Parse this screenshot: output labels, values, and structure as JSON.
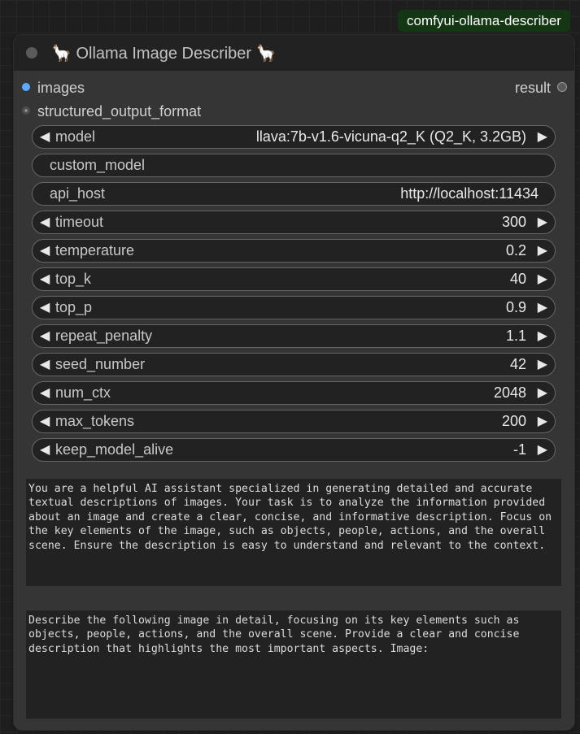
{
  "badge": "comfyui-ollama-describer",
  "node": {
    "title": "🦙 Ollama Image Describer 🦙",
    "inputs": [
      {
        "label": "images",
        "color": "#5fa8ff"
      },
      {
        "label": "structured_output_format",
        "color": "#8a8a8a"
      }
    ],
    "output": {
      "label": "result",
      "color": "#5a5a5a"
    },
    "widgets": {
      "model": {
        "label": "model",
        "value": "llava:7b-v1.6-vicuna-q2_K (Q2_K, 3.2GB)"
      },
      "custom_model": {
        "label": "custom_model",
        "value": ""
      },
      "api_host": {
        "label": "api_host",
        "value": "http://localhost:11434"
      },
      "timeout": {
        "label": "timeout",
        "value": "300"
      },
      "temperature": {
        "label": "temperature",
        "value": "0.2"
      },
      "top_k": {
        "label": "top_k",
        "value": "40"
      },
      "top_p": {
        "label": "top_p",
        "value": "0.9"
      },
      "repeat_penalty": {
        "label": "repeat_penalty",
        "value": "1.1"
      },
      "seed_number": {
        "label": "seed_number",
        "value": "42"
      },
      "num_ctx": {
        "label": "num_ctx",
        "value": "2048"
      },
      "max_tokens": {
        "label": "max_tokens",
        "value": "200"
      },
      "keep_model_alive": {
        "label": "keep_model_alive",
        "value": "-1"
      }
    },
    "system_prompt": "You are a helpful AI assistant specialized in generating detailed and accurate\ntextual descriptions of images. Your task is to analyze the information provided\nabout an image and create a clear, concise, and informative description. Focus on\nthe key elements of the image, such as objects, people, actions, and the overall\nscene. Ensure the description is easy to understand and relevant to the context.",
    "prompt": "Describe the following image in detail, focusing on its key elements such as\nobjects, people, actions, and the overall scene. Provide a clear and concise\ndescription that highlights the most important aspects. Image:"
  }
}
